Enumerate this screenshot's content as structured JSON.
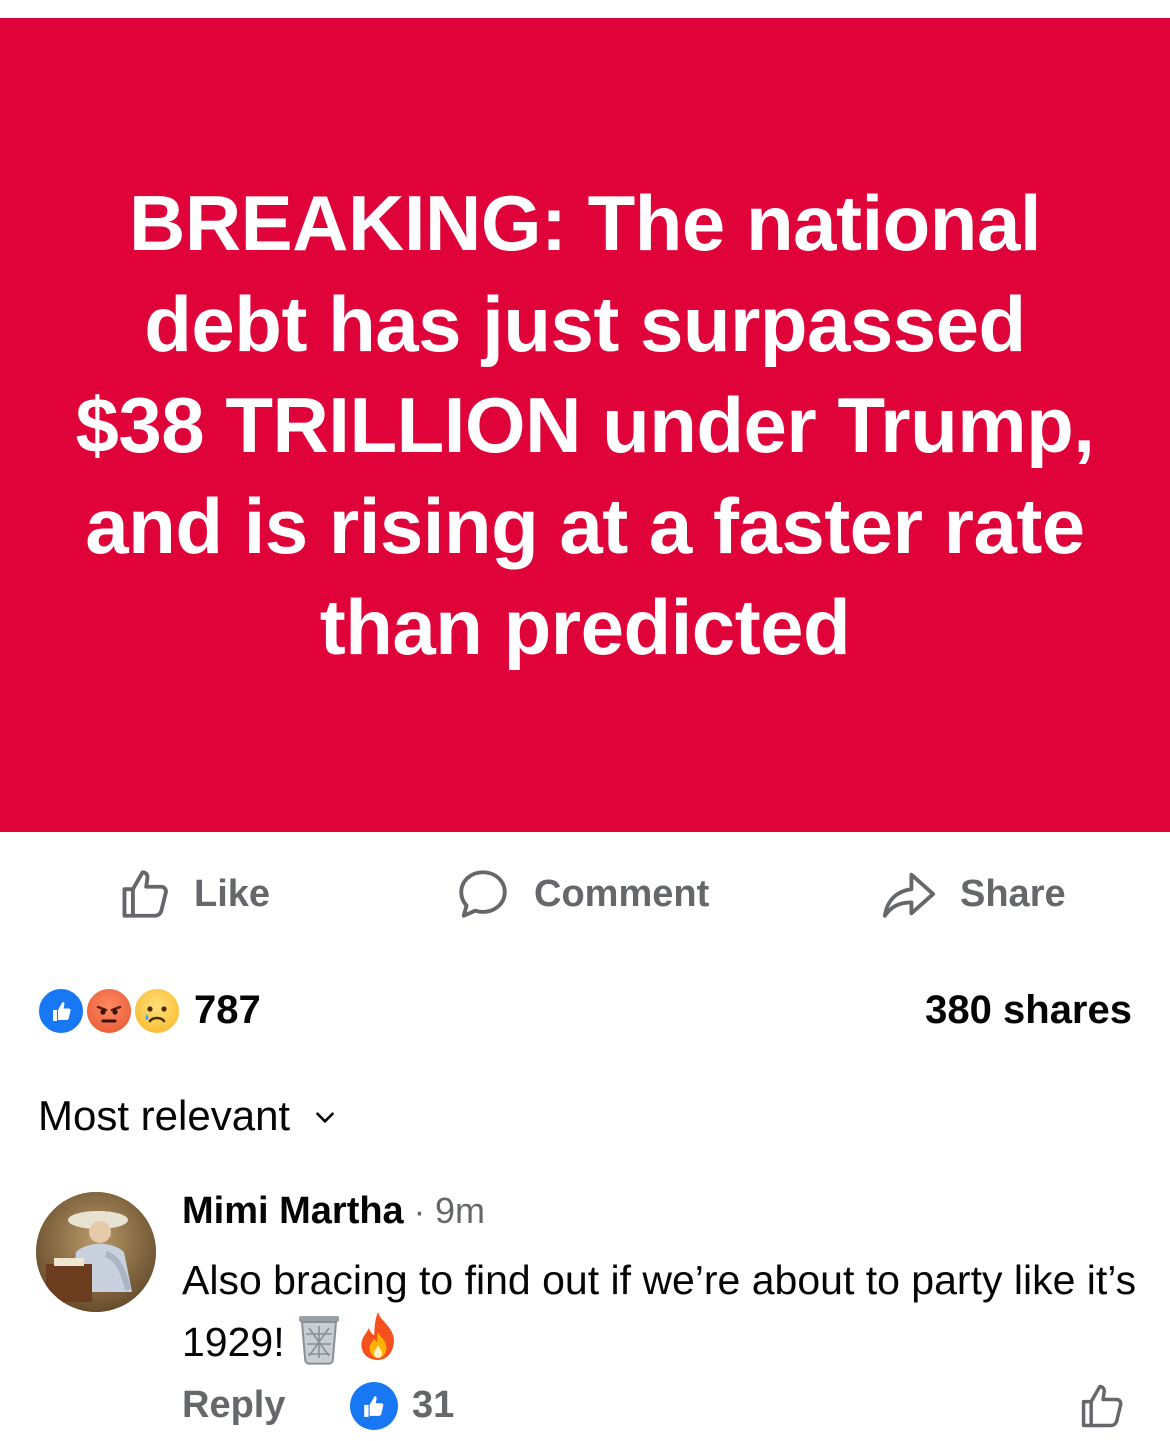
{
  "post": {
    "headline": "BREAKING: The national debt has just surpassed $38 TRILLION under Trump, and is rising at a faster rate than predicted",
    "background_color": "#e0033a"
  },
  "actions": {
    "like": "Like",
    "comment": "Comment",
    "share": "Share"
  },
  "stats": {
    "reactions": [
      "like-icon",
      "angry-icon",
      "sad-icon"
    ],
    "reaction_count": "787",
    "shares": "380 shares"
  },
  "comments": {
    "sort_label": "Most relevant",
    "items": [
      {
        "author": "Mimi Martha",
        "separator": "·",
        "time": "9m",
        "text": "Also bracing to find out if we’re about to party like it’s 1929!",
        "emojis": [
          "wastebasket-icon",
          "fire-icon"
        ],
        "reply_label": "Reply",
        "like_count": "31"
      }
    ]
  }
}
